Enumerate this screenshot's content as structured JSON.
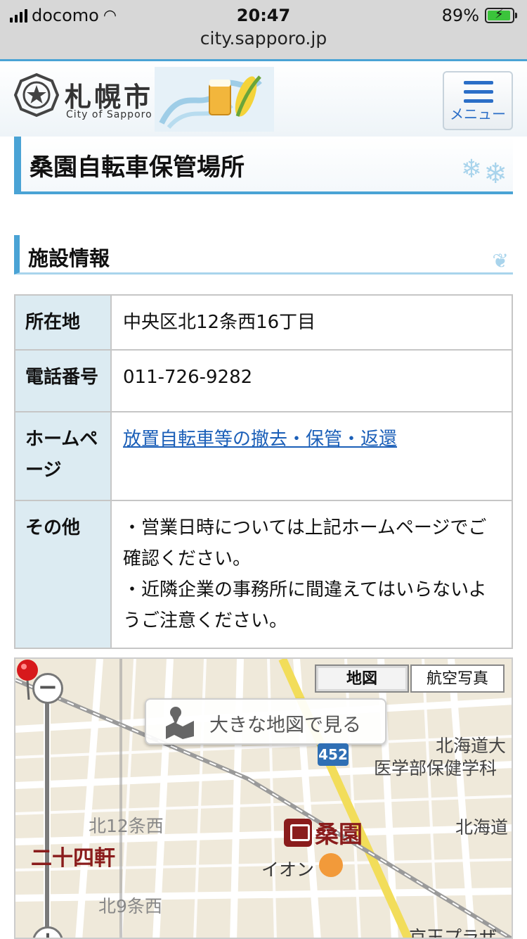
{
  "status_bar": {
    "carrier": "docomo",
    "time": "20:47",
    "battery": "89%",
    "battery_level": 0.89,
    "url": "city.sapporo.jp"
  },
  "header": {
    "logo_title": "札幌市",
    "logo_subtitle": "City of Sapporo",
    "menu_label": "メニュー"
  },
  "page": {
    "title": "桑園自転車保管場所",
    "section_title": "施設情報"
  },
  "info_table": {
    "address_label": "所在地",
    "address_value": "中央区北12条西16丁目",
    "phone_label": "電話番号",
    "phone_value": "011-726-9282",
    "homepage_label": "ホームページ",
    "homepage_link": "放置自転車等の撤去・保管・返還",
    "other_label": "その他",
    "other_line1": "・営業日時については上記ホームページでご確認ください。",
    "other_line2": "・近隣企業の事務所に間違えてはいらないようご注意ください。"
  },
  "map": {
    "type_map": "地図",
    "type_aerial": "航空写真",
    "big_map_button": "大きな地図で見る",
    "zoom_out": "−",
    "zoom_in": "+",
    "route_number": "452",
    "station": "桑園",
    "labels": {
      "university": "北海道大",
      "faculty": "医学部保健学科",
      "hokkaido2": "北海道",
      "kita12": "北12条西",
      "nijuyonken": "二十四軒",
      "aeon": "イオン",
      "kita9": "北9条西",
      "keio": "京王プラザ"
    }
  }
}
